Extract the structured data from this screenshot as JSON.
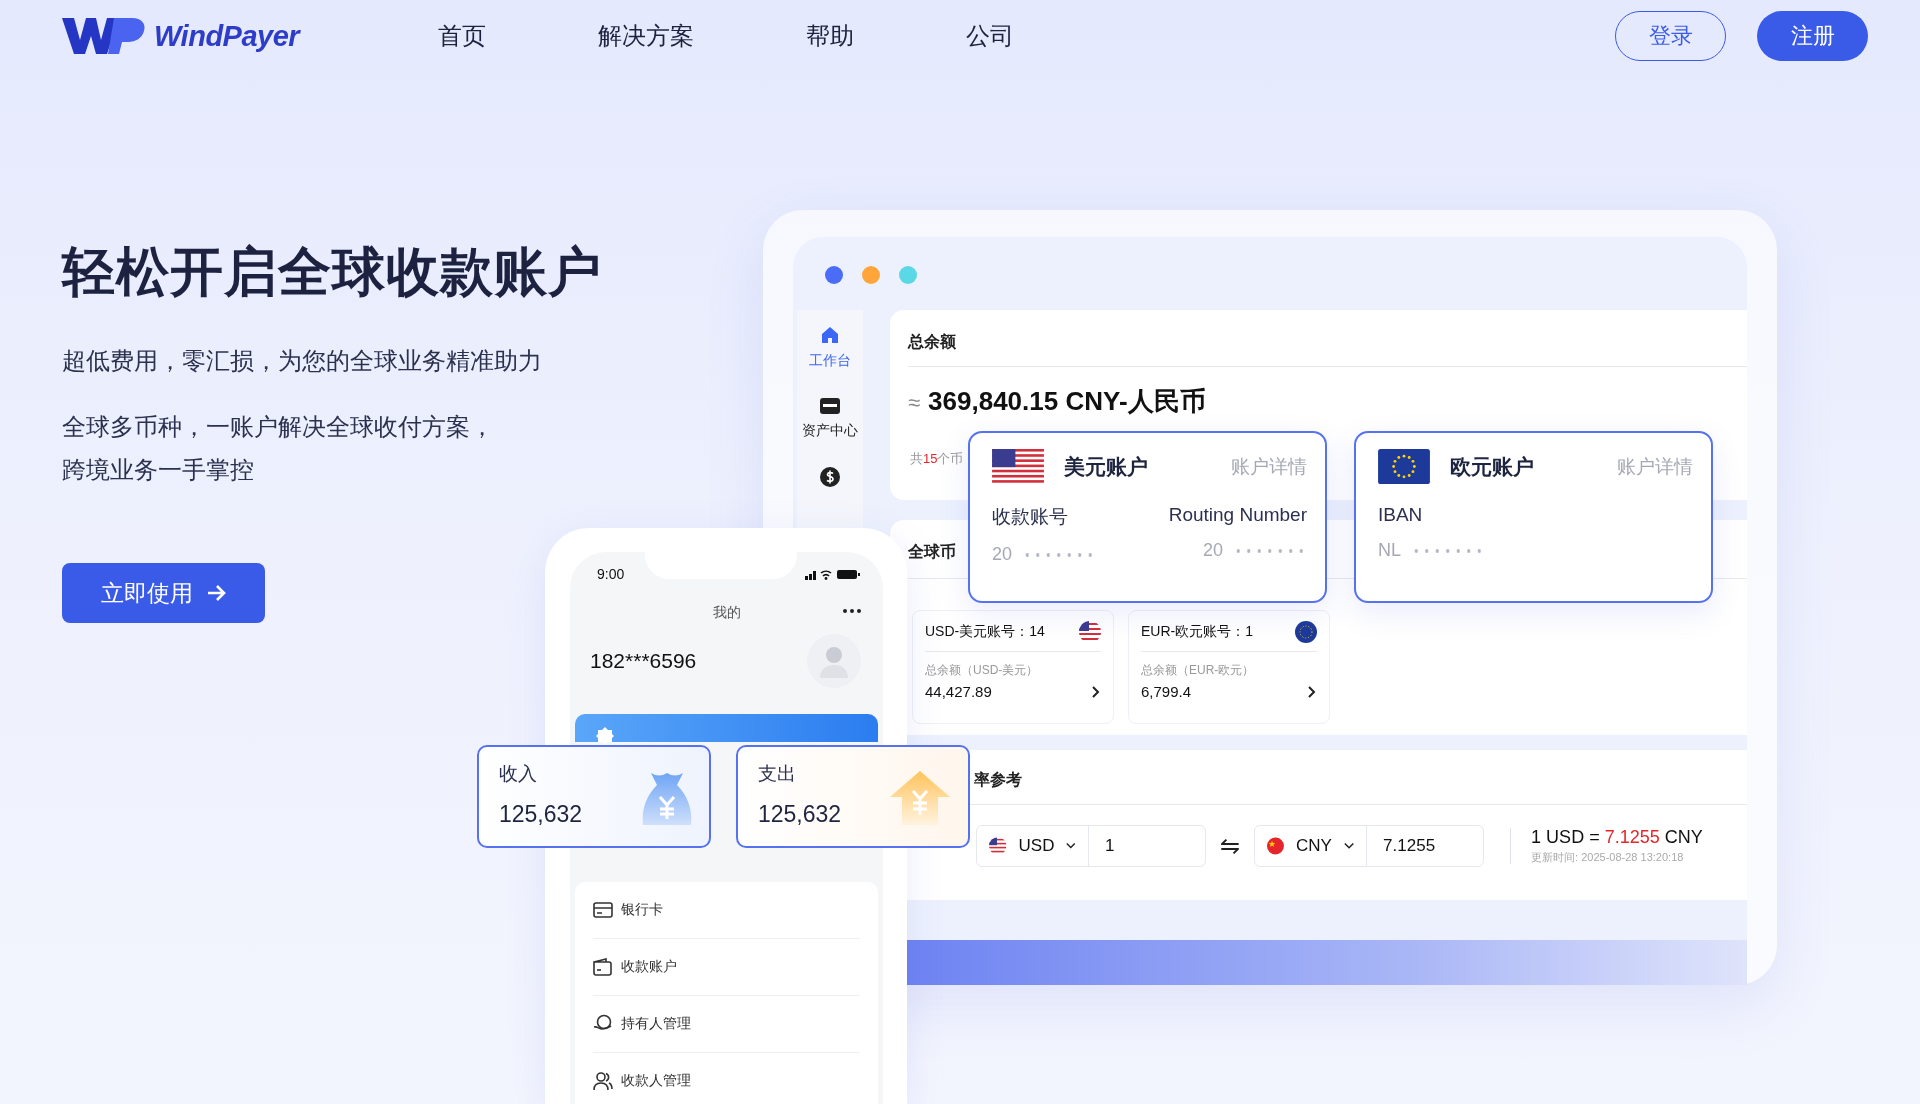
{
  "logo": {
    "text": "WindPayer"
  },
  "nav": [
    {
      "label": "首页"
    },
    {
      "label": "解决方案"
    },
    {
      "label": "帮助"
    },
    {
      "label": "公司"
    }
  ],
  "auth": {
    "login": "登录",
    "signup": "注册"
  },
  "hero": {
    "title": "轻松开启全球收款账户",
    "subtitle": "超低费用，零汇损，为您的全球业务精准助力",
    "description": [
      "全球多币种，一账户解决全球收付方案，",
      "跨境业务一手掌控"
    ],
    "cta": "立即使用"
  },
  "dashboard": {
    "window_dots": [
      {
        "color": "#4a6cf7"
      },
      {
        "color": "#ffa53a"
      },
      {
        "color": "#5ad8e6"
      }
    ],
    "sidebar": [
      {
        "kind": "home",
        "label": "工作台",
        "selected": true
      },
      {
        "kind": "card",
        "label": "资产中心",
        "selected": false
      },
      {
        "kind": "dollar",
        "selected": false
      }
    ],
    "balance": {
      "title": "总余额",
      "approx": "≈",
      "amount": "369,840.15 CNY-人民币",
      "currency_count": "共**15**个币"
    },
    "accounts": [
      {
        "kind": "us",
        "name": "美元账户",
        "link": "账户详情",
        "fields": [
          {
            "label": "收款账号",
            "value": "20"
          },
          {
            "label": "Routing Number",
            "value": "20"
          }
        ]
      },
      {
        "kind": "eu",
        "name": "欧元账户",
        "link": "账户详情",
        "fields": [
          {
            "label": "IBAN",
            "value": "NL"
          }
        ]
      }
    ],
    "currencies_title": "全球币",
    "currency_cards": [
      {
        "kind": "us",
        "title": "USD-美元账号：14",
        "balance_label": "总余额（USD-美元）",
        "balance": "44,427.89"
      },
      {
        "kind": "eu",
        "title": "EUR-欧元账号：1",
        "balance_label": "总余额（EUR-欧元）",
        "balance": "6,799.4"
      }
    ],
    "rates": {
      "title": "率参考",
      "from": {
        "kind": "us",
        "currency": "USD",
        "amount": "1"
      },
      "swap": "⇋",
      "to": {
        "kind": "cn",
        "currency": "CNY",
        "amount": "7.1255"
      },
      "result": "1 USD = **7.1255** CNY",
      "updated": "更新时间: 2025-08-28 13:20:18"
    }
  },
  "phone": {
    "time": "9:00",
    "title": "我的",
    "user": "182***6596",
    "menu": [
      {
        "kind": "card",
        "label": "银行卡"
      },
      {
        "kind": "wallet",
        "label": "收款账户"
      },
      {
        "kind": "holder",
        "label": "持有人管理"
      },
      {
        "kind": "person",
        "label": "收款人管理"
      }
    ]
  },
  "stats": [
    {
      "kind": "income",
      "label": "收入",
      "value": "125,632"
    },
    {
      "kind": "expense",
      "label": "支出",
      "value": "125,632"
    }
  ]
}
